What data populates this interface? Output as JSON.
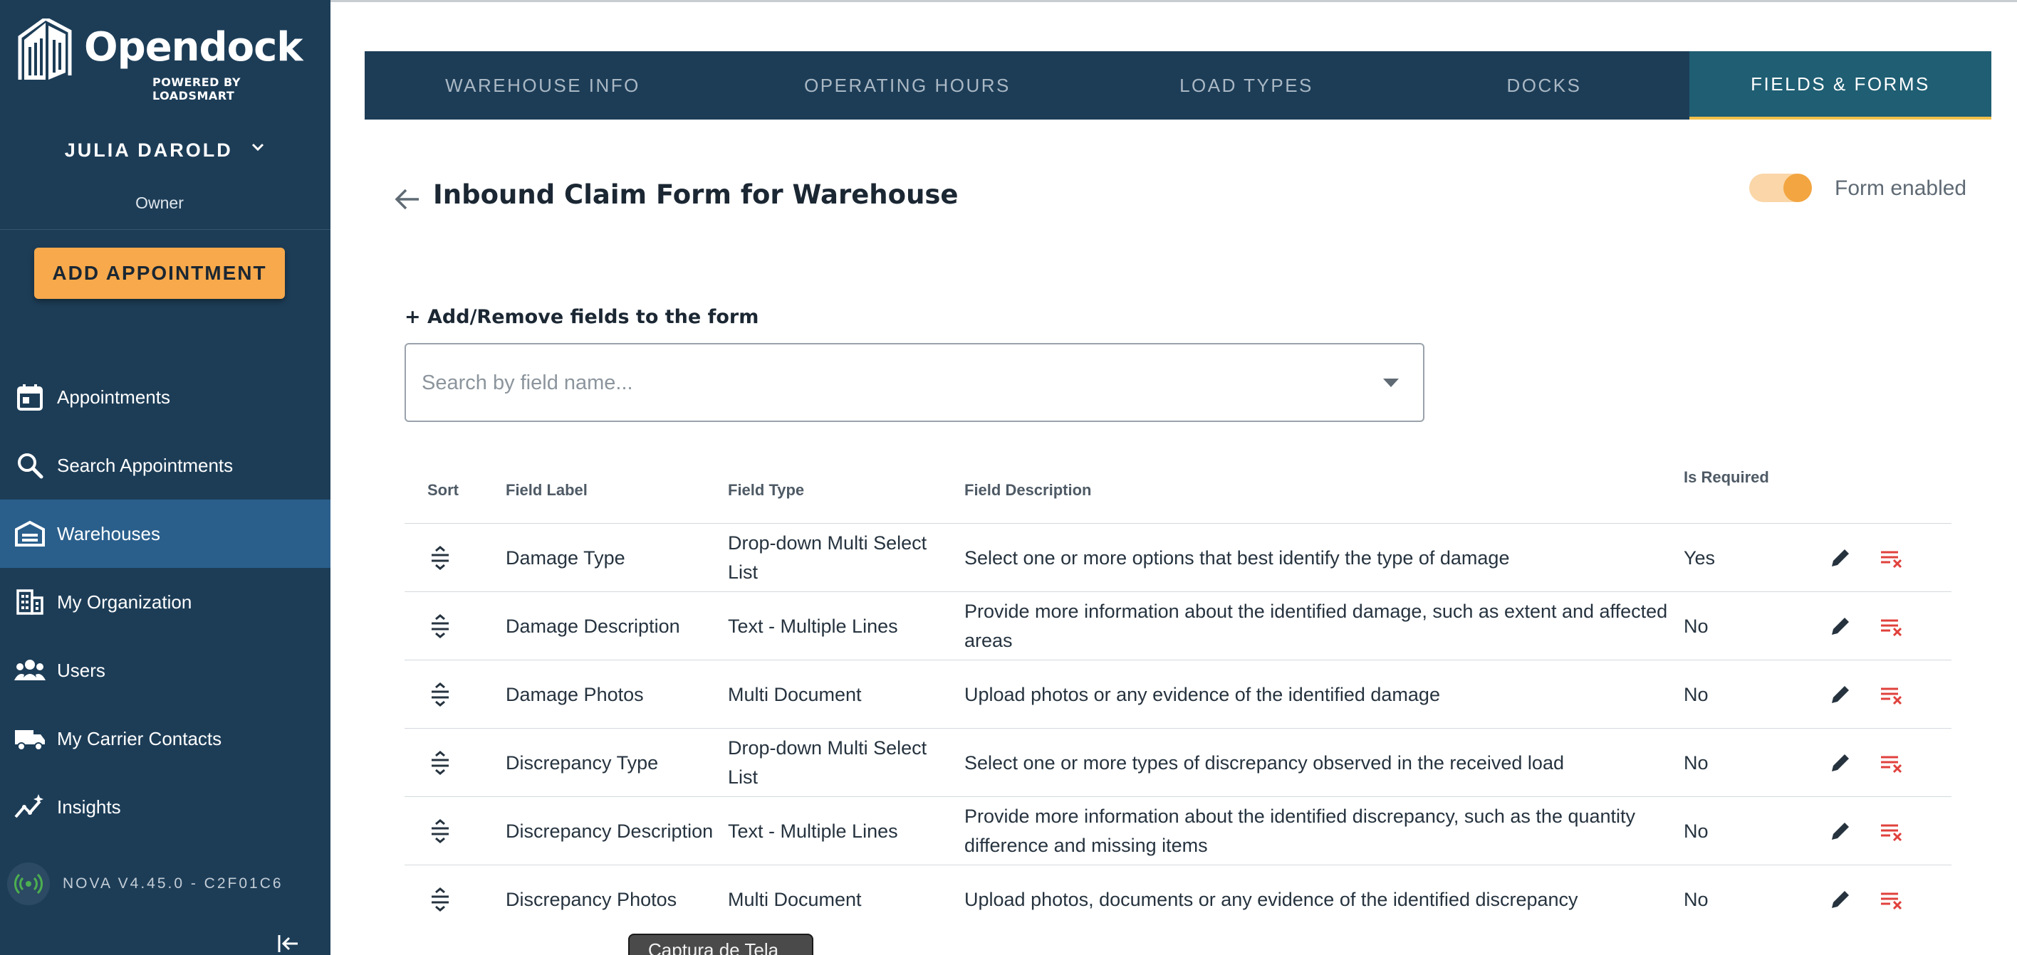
{
  "brand": {
    "name": "Opendock",
    "tagline": "POWERED BY LOADSMART"
  },
  "user": {
    "name": "JULIA DAROLD",
    "role": "Owner"
  },
  "sidebar": {
    "add_appointment": "ADD APPOINTMENT",
    "items": [
      {
        "label": "Appointments",
        "icon": "calendar-icon"
      },
      {
        "label": "Search Appointments",
        "icon": "search-icon"
      },
      {
        "label": "Warehouses",
        "icon": "warehouse-icon",
        "active": true
      },
      {
        "label": "My Organization",
        "icon": "building-icon"
      },
      {
        "label": "Users",
        "icon": "users-icon"
      },
      {
        "label": "My Carrier Contacts",
        "icon": "truck-icon"
      },
      {
        "label": "Insights",
        "icon": "insights-icon"
      }
    ],
    "version": "NOVA V4.45.0 - C2F01C6"
  },
  "tabs": [
    {
      "label": "WAREHOUSE INFO"
    },
    {
      "label": "OPERATING HOURS"
    },
    {
      "label": "LOAD TYPES"
    },
    {
      "label": "DOCKS"
    },
    {
      "label": "FIELDS & FORMS",
      "active": true
    }
  ],
  "page": {
    "title": "Inbound Claim Form for Warehouse",
    "toggle_label": "Form enabled",
    "toggle_on": true,
    "add_fields_label": "+ Add/Remove fields to the form",
    "search_placeholder": "Search by field name...",
    "search_value": ""
  },
  "table": {
    "headers": {
      "sort": "Sort",
      "label": "Field Label",
      "type": "Field Type",
      "description": "Field Description",
      "required": "Is Required"
    },
    "rows": [
      {
        "label": "Damage Type",
        "type": "Drop-down Multi Select List",
        "description": "Select one or more options that best identify the type of damage",
        "required": "Yes"
      },
      {
        "label": "Damage Description",
        "type": "Text - Multiple Lines",
        "description": "Provide more information about the identified damage, such as extent and affected areas",
        "required": "No"
      },
      {
        "label": "Damage Photos",
        "type": "Multi Document",
        "description": "Upload photos or any evidence of the identified damage",
        "required": "No"
      },
      {
        "label": "Discrepancy Type",
        "type": "Drop-down Multi Select List",
        "description": "Select one or more types of discrepancy observed in the received load",
        "required": "No"
      },
      {
        "label": "Discrepancy Description",
        "type": "Text - Multiple Lines",
        "description": "Provide more information about the identified discrepancy, such as the quantity difference and missing items",
        "required": "No"
      },
      {
        "label": "Discrepancy Photos",
        "type": "Multi Document",
        "description": "Upload photos, documents or any evidence of the identified discrepancy",
        "required": "No"
      }
    ]
  },
  "tooltip": "Captura de Tela",
  "colors": {
    "sidebar_bg": "#1d3d57",
    "sidebar_active": "#2a5f8c",
    "accent_orange": "#f7a94b",
    "tab_active": "#1f5e73",
    "tab_underline": "#f2c04a",
    "delete_red": "#e0413c",
    "status_green": "#4caf50"
  }
}
